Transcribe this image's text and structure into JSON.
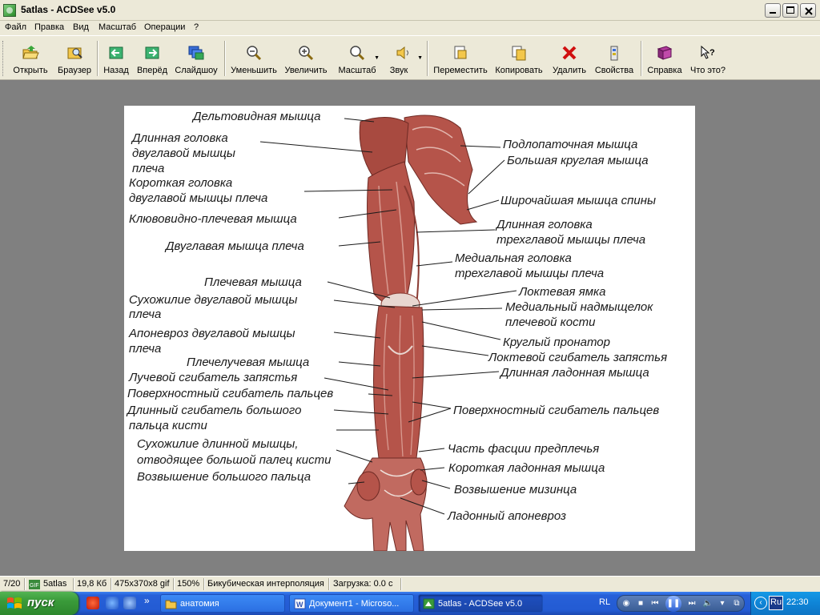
{
  "window": {
    "title": "5atlas - ACDSee v5.0"
  },
  "menu": [
    "Файл",
    "Правка",
    "Вид",
    "Масштаб",
    "Операции",
    "?"
  ],
  "toolbar": {
    "open": "Открыть",
    "browser": "Браузер",
    "back": "Назад",
    "forward": "Вперёд",
    "slideshow": "Слайдшоу",
    "zoom_out": "Уменьшить",
    "zoom_in": "Увеличить",
    "zoom": "Масштаб",
    "sound": "Звук",
    "move": "Переместить",
    "copy": "Копировать",
    "delete": "Удалить",
    "properties": "Свойства",
    "help": "Справка",
    "whats_this": "Что это?"
  },
  "image_labels": {
    "l1": "Дельтовидная мышца",
    "l2": "Длинная головка",
    "l3": "двуглавой мышцы",
    "l4": "плеча",
    "l5": "Короткая головка",
    "l6": "двуглавой мышцы плеча",
    "l7": "Клювовидно-плечевая мышца",
    "l8": "Двуглавая мышца плеча",
    "l9": "Плечевая мышца",
    "l10": "Сухожилие двуглавой мышцы",
    "l11": "плеча",
    "l12": "Апоневроз двуглавой мышцы",
    "l13": "плеча",
    "l14": "Плечелучевая мышца",
    "l15": "Лучевой сгибатель запястья",
    "l16": "Поверхностный сгибатель пальцев",
    "l17": "Длинный сгибатель большого",
    "l18": "пальца кисти",
    "l19": "Сухожилие длинной мышцы,",
    "l20": "отводящее большой палец кисти",
    "l21": "Возвышение большого пальца",
    "r1": "Подлопаточная мышца",
    "r2": "Большая круглая мышца",
    "r3": "Широчайшая мышца спины",
    "r4": "Длинная головка",
    "r5": "трехглавой мышцы плеча",
    "r6": "Медиальная головка",
    "r7": "трехглавой мышцы плеча",
    "r8": "Локтевая ямка",
    "r9": "Медиальный надмыщелок",
    "r10": "плечевой кости",
    "r11": "Круглый пронатор",
    "r12": "Локтевой сгибатель запястья",
    "r13": "Длинная ладонная мышца",
    "r14": "Поверхностный сгибатель пальцев",
    "r15": "Часть фасции предплечья",
    "r16": "Короткая ладонная мышца",
    "r17": "Возвышение мизинца",
    "r18": "Ладонный апоневроз"
  },
  "status": {
    "index": "7/20",
    "folder": "5atlas",
    "size": "19,8 Кб",
    "dims": "475x370x8 gif",
    "zoom": "150%",
    "interp": "Бикубическая интерполяция",
    "load": "Загрузка: 0.0 с"
  },
  "taskbar": {
    "start": "пуск",
    "tasks": [
      "анатомия",
      "Документ1 - Microso...",
      "5atlas - ACDSee v5.0"
    ],
    "lang1": "RL",
    "lang2": "Ru",
    "clock": "22:30"
  },
  "colors": {
    "muscle": "#b5544a",
    "muscle_dark": "#8a3a32",
    "tendon": "#e8d6d0",
    "taskbar": "#245edb",
    "start": "#3a9a3a"
  }
}
